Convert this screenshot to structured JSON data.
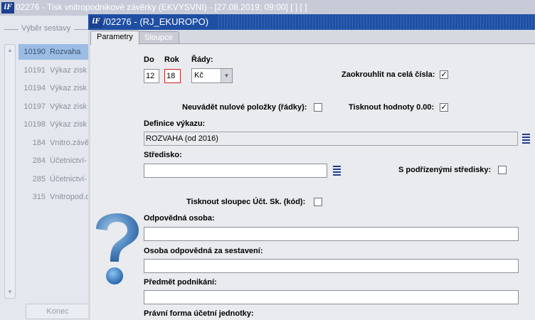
{
  "background_window": {
    "title": "02276 - Tisk vnitropodnikové závěrky (EKVYSVNI) - [27.08.2019; 09:00]  [ ]  [ ]",
    "logo": "iF",
    "group_label": "Výběr sestavy",
    "reports": [
      {
        "code": "10190",
        "name": "Rozvaha",
        "selected": true
      },
      {
        "code": "10191",
        "name": "Výkaz zisk"
      },
      {
        "code": "10194",
        "name": "Výkaz zisk"
      },
      {
        "code": "10197",
        "name": "Výkaz zisk"
      },
      {
        "code": "10198",
        "name": "Výkaz zisk"
      },
      {
        "code": "184",
        "name": "Vnitro.závě"
      },
      {
        "code": "284",
        "name": "Účetnictví-"
      },
      {
        "code": "285",
        "name": "Účetnictví-"
      },
      {
        "code": "315",
        "name": "Vnitropod.c"
      }
    ],
    "konec_label": "Konec"
  },
  "dialog": {
    "logo": "iF",
    "title": "/02276 - (RJ_EKUROPO)",
    "tabs": [
      {
        "label": "Parametry",
        "active": true
      },
      {
        "label": "Sloupce",
        "active": false
      }
    ]
  },
  "form": {
    "do_label": "Do",
    "do_value": "12",
    "rok_label": "Rok",
    "rok_value": "18",
    "rady_label": "Řády:",
    "rady_value": "Kč",
    "zaokrouhlit_label": "Zaokrouhlit na celá čísla:",
    "zaokrouhlit_checked": "✓",
    "neuvadet_label": "Neuvádět nulové položky (řádky):",
    "neuvadet_checked": "",
    "tisknout_hodnoty_label": "Tisknout hodnoty 0.00:",
    "tisknout_hodnoty_checked": "✓",
    "definice_label": "Definice výkazu:",
    "definice_value": "ROZVAHA (od 2016)",
    "stredisko_label": "Středisko:",
    "stredisko_value": "",
    "podrizenymi_label": "S podřízenými středisky:",
    "podrizenymi_checked": "",
    "tisknout_sloupec_label": "Tisknout sloupec Účt. Sk. (kód):",
    "tisknout_sloupec_checked": "",
    "odpovedna_label": "Odpovědná osoba:",
    "odpovedna_value": "",
    "osoba_sestaveni_label": "Osoba odpovědná za sestavení:",
    "osoba_sestaveni_value": "",
    "predmet_label": "Předmět podnikání:",
    "predmet_value": "",
    "pravni_forma_label": "Právní forma účetní jednotky:"
  },
  "colors": {
    "title_bar_active": "#1f4fa3",
    "title_bar_inactive": "#c7cbd8",
    "selection": "#9bbde4",
    "required_border": "#d22020"
  }
}
